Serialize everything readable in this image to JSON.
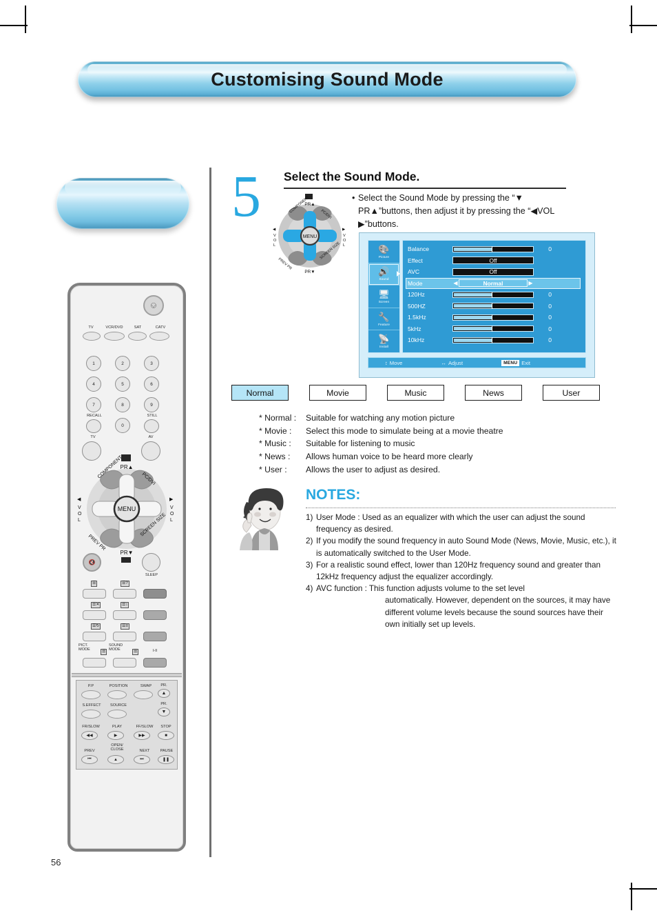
{
  "document": {
    "title": "Customising Sound Mode",
    "page_number": "56"
  },
  "step": {
    "number": "5",
    "heading": "Select the Sound Mode.",
    "instruction": "Select the Sound Mode by pressing the “▼ PR▲”buttons, then adjust it by pressing the “◀VOL ▶”buttons."
  },
  "navpad": {
    "top_label": "PR▲",
    "bottom_label": "PR▼",
    "left_label": "VOL",
    "right_label": "VOL",
    "center_label": "MENU",
    "corner_top_left": "COMPONENT",
    "corner_top_right": "PC/DVI",
    "corner_bottom_left": "PREV PR",
    "corner_bottom_right": "SCREEN SIZE"
  },
  "osd": {
    "sidebar": [
      {
        "label": "Picture",
        "icon": "picture-icon",
        "active": false
      },
      {
        "label": "Sound",
        "icon": "sound-icon",
        "active": true
      },
      {
        "label": "Screen",
        "icon": "screen-icon",
        "active": false
      },
      {
        "label": "Feature",
        "icon": "feature-icon",
        "active": false
      },
      {
        "label": "Install",
        "icon": "install-icon",
        "active": false
      }
    ],
    "rows": [
      {
        "label": "Balance",
        "type": "slider",
        "value": "0",
        "fill_pct": 50,
        "tick_pct": 50
      },
      {
        "label": "Effect",
        "type": "option",
        "value": "Off"
      },
      {
        "label": "AVC",
        "type": "option",
        "value": "Off"
      },
      {
        "label": "Mode",
        "type": "option",
        "value": "Normal",
        "selected": true,
        "left_arrow": "◀",
        "right_arrow": "▶"
      },
      {
        "label": "120Hz",
        "type": "slider",
        "value": "0",
        "fill_pct": 50,
        "tick_pct": 50
      },
      {
        "label": "500HZ",
        "type": "slider",
        "value": "0",
        "fill_pct": 50,
        "tick_pct": 50
      },
      {
        "label": "1.5kHz",
        "type": "slider",
        "value": "0",
        "fill_pct": 50,
        "tick_pct": 50
      },
      {
        "label": "5kHz",
        "type": "slider",
        "value": "0",
        "fill_pct": 50,
        "tick_pct": 50
      },
      {
        "label": "10kHz",
        "type": "slider",
        "value": "0",
        "fill_pct": 50,
        "tick_pct": 50
      }
    ],
    "footer": {
      "move_icon": "up-down-arrow-icon",
      "move_label": "Move",
      "adjust_icon": "left-right-arrow-icon",
      "adjust_label": "Adjust",
      "menu_key": "MENU",
      "exit_label": "Exit"
    }
  },
  "mode_buttons": [
    {
      "label": "Normal",
      "selected": true
    },
    {
      "label": "Movie",
      "selected": false
    },
    {
      "label": "Music",
      "selected": false
    },
    {
      "label": "News",
      "selected": false
    },
    {
      "label": "User",
      "selected": false
    }
  ],
  "mode_descriptions": [
    {
      "key": "* Normal :",
      "text": "Suitable for watching any motion picture"
    },
    {
      "key": "* Movie :",
      "text": "Select this mode to simulate being at a movie theatre"
    },
    {
      "key": "* Music :",
      "text": "Suitable for listening to music"
    },
    {
      "key": "* News :",
      "text": "Allows human voice to be heard more clearly"
    },
    {
      "key": "* User :",
      "text": "Allows the user to adjust as desired."
    }
  ],
  "notes": {
    "title": "NOTES:",
    "items": [
      {
        "num": "1)",
        "text": "User Mode : Used as an equalizer with which the user can adjust the sound frequency as desired."
      },
      {
        "num": "2)",
        "text": "If you modify the sound frequency in auto Sound Mode (News, Movie, Music, etc.), it is automatically switched to the User Mode."
      },
      {
        "num": "3)",
        "text": "For a realistic sound effect, lower than 120Hz frequency sound and greater than 12kHz frequency adjust the equalizer accordingly."
      },
      {
        "num": "4)",
        "text": "AVC function : This function adjusts volume to the set level",
        "cont": "automatically. However, dependent on the sources, it may have different volume levels because the sound sources have their own initially set up levels."
      }
    ]
  },
  "remote": {
    "power_icon": "power-icon",
    "source_keys": [
      "TV",
      "VCR/DVD",
      "SAT",
      "CATV"
    ],
    "numbers": [
      "1",
      "2",
      "3",
      "4",
      "5",
      "6",
      "7",
      "8",
      "9",
      "0"
    ],
    "recall_label": "RECALL",
    "still_label": "STILL",
    "tv_label": "TV",
    "av_label": "AV",
    "navpad": {
      "top": "PR▲",
      "bottom": "PR▼",
      "left": "VOL",
      "right": "VOL",
      "center": "MENU",
      "component": "COMPONENT",
      "pcdvi": "PC/DVI",
      "prev_pr": "PREV PR",
      "screen_size": "SCREEN SIZE"
    },
    "sleep_label": "SLEEP",
    "mute_icon": "mute-icon",
    "pict_mode_label": "PICT.\nMODE",
    "sound_mode_label": "SOUND\nMODE",
    "dual_label": "I-II",
    "vcr": {
      "pp": "P.P",
      "position": "POSITION",
      "swap": "SWAP",
      "s_effect": "S.EFFECT",
      "source": "SOURCE",
      "pr_up": "PR.",
      "pr_down": "PR.",
      "fr_slow": "FR/SLOW",
      "play": "PLAY",
      "ff_slow": "FF/SLOW",
      "stop": "STOP",
      "prev": "PREV",
      "open_close": "OPEN/\nCLOSE",
      "next": "NEXT",
      "pause": "PAUSE"
    }
  },
  "colors": {
    "accent": "#29a8e0",
    "osd_bg": "#2f9bd4",
    "osd_outer": "#d5eefa",
    "selected_mode": "#b5e5f7"
  }
}
